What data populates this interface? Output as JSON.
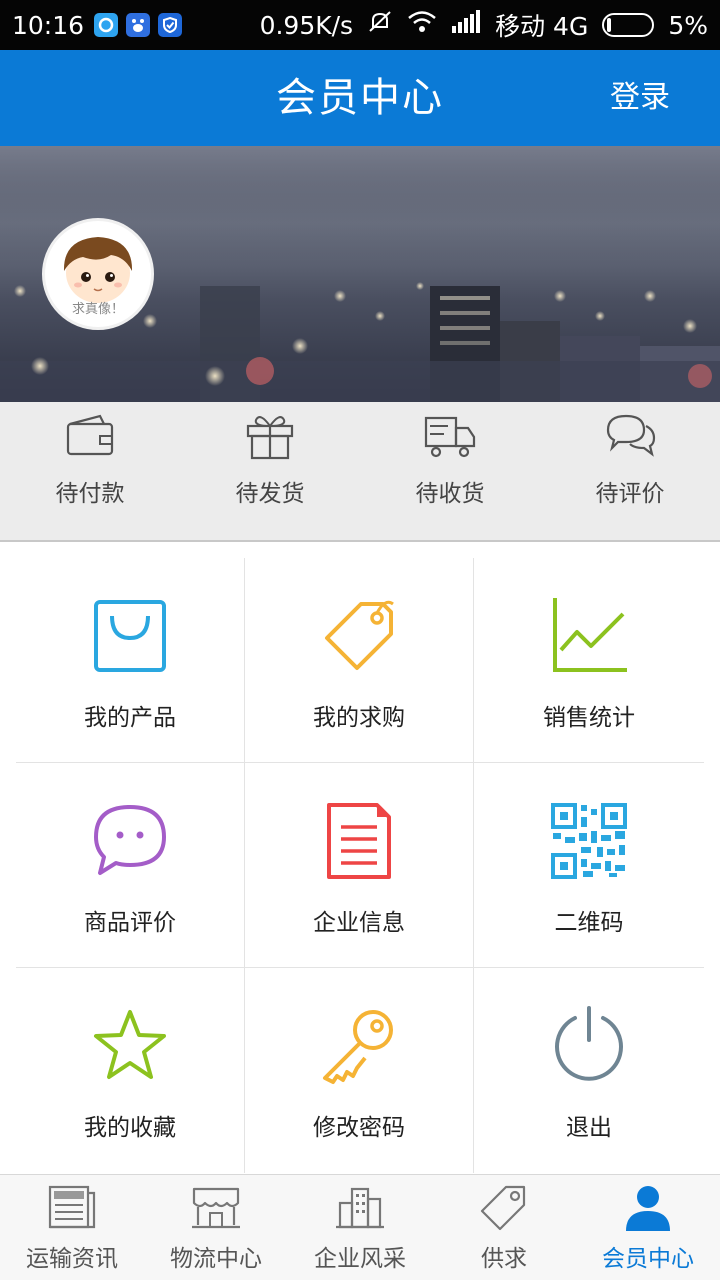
{
  "status_bar": {
    "time": "10:16",
    "network_speed": "0.95K/s",
    "carrier": "移动 4G",
    "battery": "5%",
    "app_icons": [
      "browser-icon",
      "baidu-icon",
      "shield-icon"
    ]
  },
  "header": {
    "title": "会员中心",
    "login_label": "登录",
    "color": "#0b7ad6"
  },
  "profile": {
    "avatar_caption": "求真像！"
  },
  "order_status": [
    {
      "label": "待付款",
      "icon": "wallet-icon"
    },
    {
      "label": "待发货",
      "icon": "gift-icon"
    },
    {
      "label": "待收货",
      "icon": "truck-icon"
    },
    {
      "label": "待评价",
      "icon": "chat-bubbles-icon"
    }
  ],
  "menu": [
    {
      "label": "我的产品",
      "icon": "shopping-bag-icon",
      "color": "#2aa7e0"
    },
    {
      "label": "我的求购",
      "icon": "price-tag-icon",
      "color": "#f5b335"
    },
    {
      "label": "销售统计",
      "icon": "line-chart-icon",
      "color": "#8cc21f"
    },
    {
      "label": "商品评价",
      "icon": "speech-bubble-icon",
      "color": "#a45dc8"
    },
    {
      "label": "企业信息",
      "icon": "document-icon",
      "color": "#ee4545"
    },
    {
      "label": "二维码",
      "icon": "qr-code-icon",
      "color": "#2aa7e0"
    },
    {
      "label": "我的收藏",
      "icon": "star-icon",
      "color": "#8cc21f"
    },
    {
      "label": "修改密码",
      "icon": "key-icon",
      "color": "#f5b335"
    },
    {
      "label": "退出",
      "icon": "power-icon",
      "color": "#6f8593"
    }
  ],
  "bottom_nav": [
    {
      "label": "运输资讯",
      "icon": "news-icon"
    },
    {
      "label": "物流中心",
      "icon": "storefront-icon"
    },
    {
      "label": "企业风采",
      "icon": "buildings-icon"
    },
    {
      "label": "供求",
      "icon": "tag-icon"
    },
    {
      "label": "会员中心",
      "icon": "user-icon",
      "active": true
    }
  ]
}
